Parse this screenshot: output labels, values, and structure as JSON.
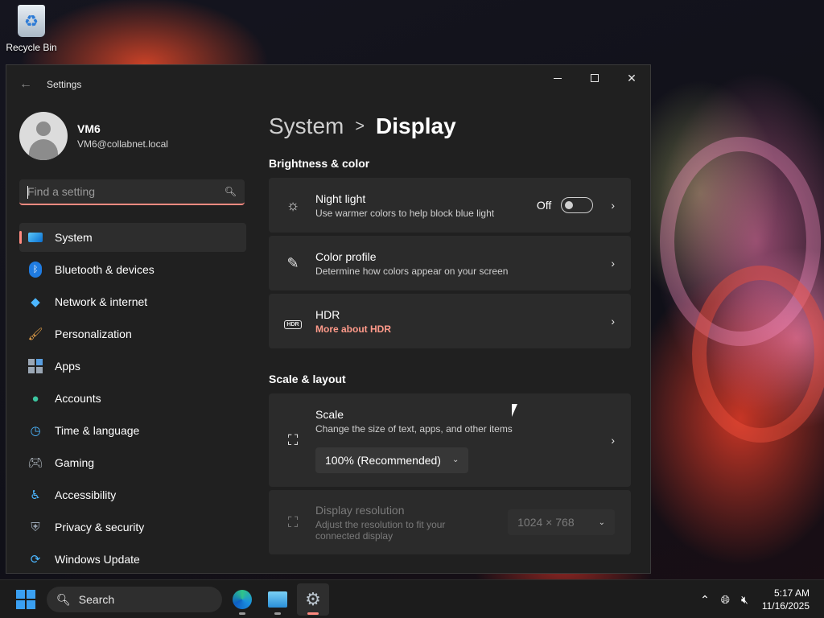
{
  "desktop": {
    "recycle_bin_label": "Recycle Bin"
  },
  "window": {
    "title": "Settings"
  },
  "profile": {
    "name": "VM6",
    "email": "VM6@collabnet.local"
  },
  "search": {
    "placeholder": "Find a setting"
  },
  "sidebar": {
    "items": [
      {
        "label": "System",
        "icon": "monitor-icon",
        "active": true
      },
      {
        "label": "Bluetooth & devices",
        "icon": "bluetooth-icon"
      },
      {
        "label": "Network & internet",
        "icon": "wifi-icon"
      },
      {
        "label": "Personalization",
        "icon": "brush-icon"
      },
      {
        "label": "Apps",
        "icon": "apps-icon"
      },
      {
        "label": "Accounts",
        "icon": "person-icon"
      },
      {
        "label": "Time & language",
        "icon": "globe-clock-icon"
      },
      {
        "label": "Gaming",
        "icon": "gamepad-icon"
      },
      {
        "label": "Accessibility",
        "icon": "accessibility-icon"
      },
      {
        "label": "Privacy & security",
        "icon": "shield-icon"
      },
      {
        "label": "Windows Update",
        "icon": "refresh-icon"
      }
    ]
  },
  "breadcrumb": {
    "parent": "System",
    "separator": ">",
    "current": "Display"
  },
  "brightness_color": {
    "heading": "Brightness & color",
    "night_light": {
      "title": "Night light",
      "subtitle": "Use warmer colors to help block blue light",
      "toggle_state": "Off"
    },
    "color_profile": {
      "title": "Color profile",
      "subtitle": "Determine how colors appear on your screen"
    },
    "hdr": {
      "icon_text": "HDR",
      "title": "HDR",
      "link": "More about HDR"
    }
  },
  "scale_layout": {
    "heading": "Scale & layout",
    "scale": {
      "title": "Scale",
      "subtitle": "Change the size of text, apps, and other items",
      "selected": "100% (Recommended)"
    },
    "resolution": {
      "title": "Display resolution",
      "subtitle": "Adjust the resolution to fit your connected display",
      "selected": "1024 × 768"
    }
  },
  "taskbar": {
    "search_label": "Search",
    "time": "5:17 AM",
    "date": "11/16/2025"
  },
  "colors": {
    "accent": "#ff8a80",
    "window_bg": "#202020",
    "card_bg": "#2b2b2b",
    "start_blue": "#3aa0f2"
  }
}
